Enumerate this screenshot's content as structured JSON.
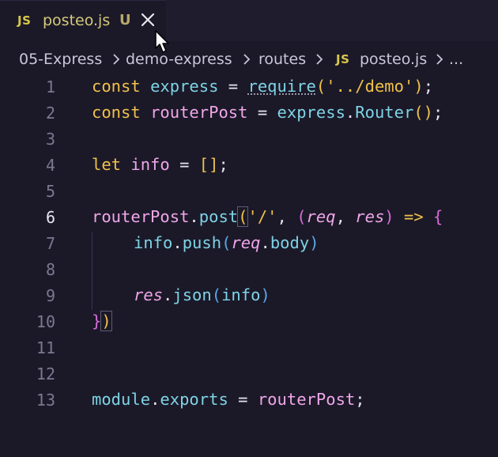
{
  "tab": {
    "badge": "JS",
    "filename": "posteo.js",
    "status": "U",
    "close_icon": "close-icon"
  },
  "breadcrumb": {
    "items": [
      "05-Express",
      "demo-express",
      "routes",
      "posteo.js",
      "..."
    ],
    "file_badge": "JS"
  },
  "editor": {
    "line_numbers": [
      "1",
      "2",
      "3",
      "4",
      "5",
      "6",
      "7",
      "8",
      "9",
      "10",
      "11",
      "12",
      "13"
    ],
    "active_line": "6",
    "lines": {
      "l1": {
        "kw": "const",
        "var": "express",
        "eq": " = ",
        "fn": "require",
        "po": "(",
        "str": "'../demo'",
        "pc": ")",
        "semi": ";"
      },
      "l2": {
        "kw": "const",
        "var": "routerPost",
        "eq": " = ",
        "obj": "express",
        "dot": ".",
        "fn": "Router",
        "po": "(",
        "pc": ")",
        "semi": ";"
      },
      "l4": {
        "kw": "let",
        "var": "info",
        "eq": " = ",
        "arr": "[]",
        "semi": ";"
      },
      "l6": {
        "obj": "routerPost",
        "dot": ".",
        "fn": "post",
        "po": "(",
        "str": "'/'",
        "comma": ", ",
        "po2": "(",
        "p1": "req",
        "comma2": ", ",
        "p2": "res",
        "pc2": ")",
        "arrow": " => ",
        "brace": "{"
      },
      "l7": {
        "obj": "info",
        "dot": ".",
        "fn": "push",
        "po": "(",
        "p": "req",
        "dot2": ".",
        "prop": "body",
        "pc": ")"
      },
      "l9": {
        "p": "res",
        "dot": ".",
        "fn": "json",
        "po": "(",
        "arg": "info",
        "pc": ")"
      },
      "l10": {
        "brace": "}",
        "pc": ")"
      },
      "l13": {
        "obj": "module",
        "dot": ".",
        "prop": "exports",
        "eq": " = ",
        "var": "routerPost",
        "semi": ";"
      }
    }
  },
  "colors": {
    "background": "#1b1928",
    "keyword": "#f0c14b",
    "variable": "#7fd3e6",
    "object": "#f0a6e9",
    "bracket_level2": "#d86cd6",
    "bracket_level3": "#5aa7e8"
  }
}
